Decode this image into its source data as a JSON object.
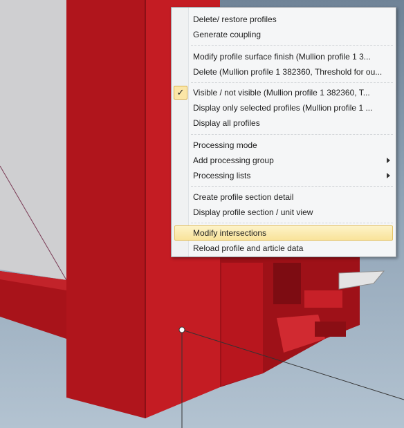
{
  "context_menu": {
    "items": [
      {
        "label": "Delete/ restore profiles"
      },
      {
        "label": "Generate coupling"
      },
      {
        "label": "Modify profile surface finish (Mullion profile 1 3..."
      },
      {
        "label": "Delete (Mullion profile 1 382360, Threshold for ou..."
      },
      {
        "label": "Visible / not visible (Mullion profile 1 382360, T...",
        "checked": true
      },
      {
        "label": "Display only selected profiles (Mullion profile 1 ..."
      },
      {
        "label": "Display all profiles"
      },
      {
        "label": "Processing mode"
      },
      {
        "label": "Add processing group",
        "submenu": true
      },
      {
        "label": "Processing lists",
        "submenu": true
      },
      {
        "label": "Create profile section detail"
      },
      {
        "label": "Display profile section / unit view"
      },
      {
        "label": "Modify intersections",
        "highlighted": true
      },
      {
        "label": "Reload profile and article data"
      }
    ],
    "check_glyph": "✓"
  },
  "colors": {
    "profile_red": "#b3141a",
    "highlight": "#f9e39a",
    "background_sky": "#8ea2b5"
  }
}
